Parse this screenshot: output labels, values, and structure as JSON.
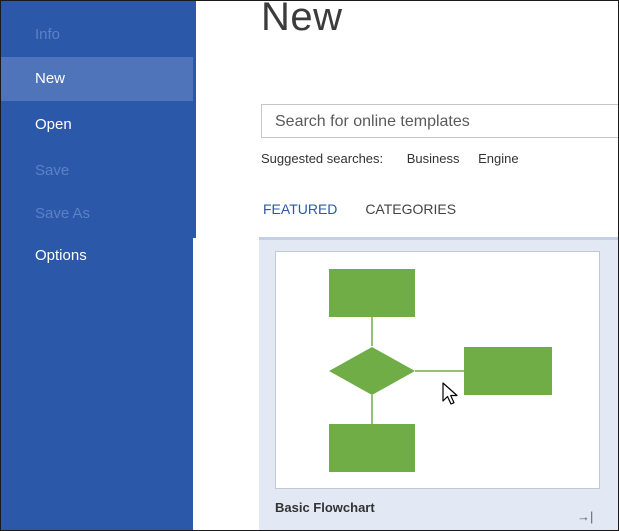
{
  "sidebar": {
    "items": [
      {
        "label": "Info",
        "state": "disabled"
      },
      {
        "label": "New",
        "state": "selected"
      },
      {
        "label": "Open",
        "state": "normal"
      },
      {
        "label": "Save",
        "state": "disabled"
      },
      {
        "label": "Save As",
        "state": "disabled"
      },
      {
        "label": "Options",
        "state": "normal"
      }
    ]
  },
  "main": {
    "title": "New",
    "search": {
      "placeholder": "Search for online templates"
    },
    "suggested": {
      "label": "Suggested searches:",
      "links": [
        "Business",
        "Engine"
      ]
    },
    "tabs": [
      {
        "label": "FEATURED",
        "active": true
      },
      {
        "label": "CATEGORIES",
        "active": false
      }
    ],
    "template": {
      "name": "Basic Flowchart",
      "pin_icon": "pin-icon",
      "shape_color": "#70ad47"
    }
  },
  "colors": {
    "sidebar": "#2b58a8",
    "sidebar_selected": "#4f74ba",
    "accent": "#2b58a8",
    "card": "#e3e8f5"
  }
}
